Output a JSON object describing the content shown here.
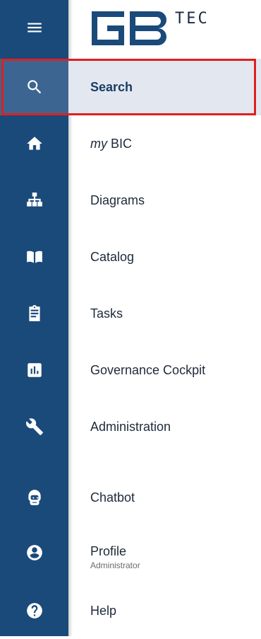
{
  "logo": {
    "tec": "TEC"
  },
  "nav": [
    {
      "key": "search",
      "icon": "search-icon",
      "label": "Search",
      "active": true
    },
    {
      "key": "mybic",
      "icon": "home-icon",
      "prefix": "my",
      "label": "BIC"
    },
    {
      "key": "diagrams",
      "icon": "sitemap-icon",
      "label": "Diagrams"
    },
    {
      "key": "catalog",
      "icon": "book-icon",
      "label": "Catalog"
    },
    {
      "key": "tasks",
      "icon": "clipboard-icon",
      "label": "Tasks"
    },
    {
      "key": "governance",
      "icon": "chart-icon",
      "label": "Governance Cockpit"
    },
    {
      "key": "administration",
      "icon": "wrench-icon",
      "label": "Administration"
    },
    {
      "key": "chatbot",
      "icon": "robot-icon",
      "label": "Chatbot"
    },
    {
      "key": "profile",
      "icon": "account-icon",
      "label": "Profile",
      "sublabel": "Administrator"
    },
    {
      "key": "help",
      "icon": "help-icon",
      "label": "Help"
    }
  ],
  "colors": {
    "rail": "#1a4a7a",
    "active_rail": "#3c6691",
    "active_item": "#e3e8f0",
    "highlight": "#e02020"
  }
}
